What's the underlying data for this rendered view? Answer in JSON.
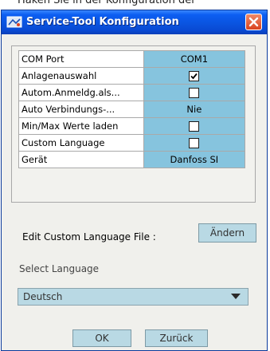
{
  "background_text": "Haken Sie in der Konfiguration der",
  "window": {
    "title": "Service-Tool Konfiguration",
    "title_icon": "window-app-icon",
    "close_icon": "close-icon"
  },
  "properties": [
    {
      "key": "COM Port",
      "type": "text",
      "value": "COM1"
    },
    {
      "key": "Anlagenauswahl",
      "type": "checkbox",
      "checked": true
    },
    {
      "key": "Autom.Anmeldg.als...",
      "type": "checkbox",
      "checked": false
    },
    {
      "key": "Auto Verbindungs-...",
      "type": "text",
      "value": "Nie"
    },
    {
      "key": "Min/Max Werte laden",
      "type": "checkbox",
      "checked": false
    },
    {
      "key": "Custom Language",
      "type": "checkbox",
      "checked": false
    },
    {
      "key": "Gerät",
      "type": "text",
      "value": "Danfoss SI"
    }
  ],
  "edit_custom_language": {
    "label": "Edit Custom Language File :",
    "button": "Ändern"
  },
  "language": {
    "label": "Select Language",
    "selected": "Deutsch",
    "arrow_icon": "chevron-down-icon"
  },
  "buttons": {
    "ok": "OK",
    "back": "Zurück"
  },
  "colors": {
    "titlebar": "#0a54e0",
    "value_cell": "#86c4de",
    "button": "#b9d9e4",
    "close_button": "#d9431e"
  }
}
